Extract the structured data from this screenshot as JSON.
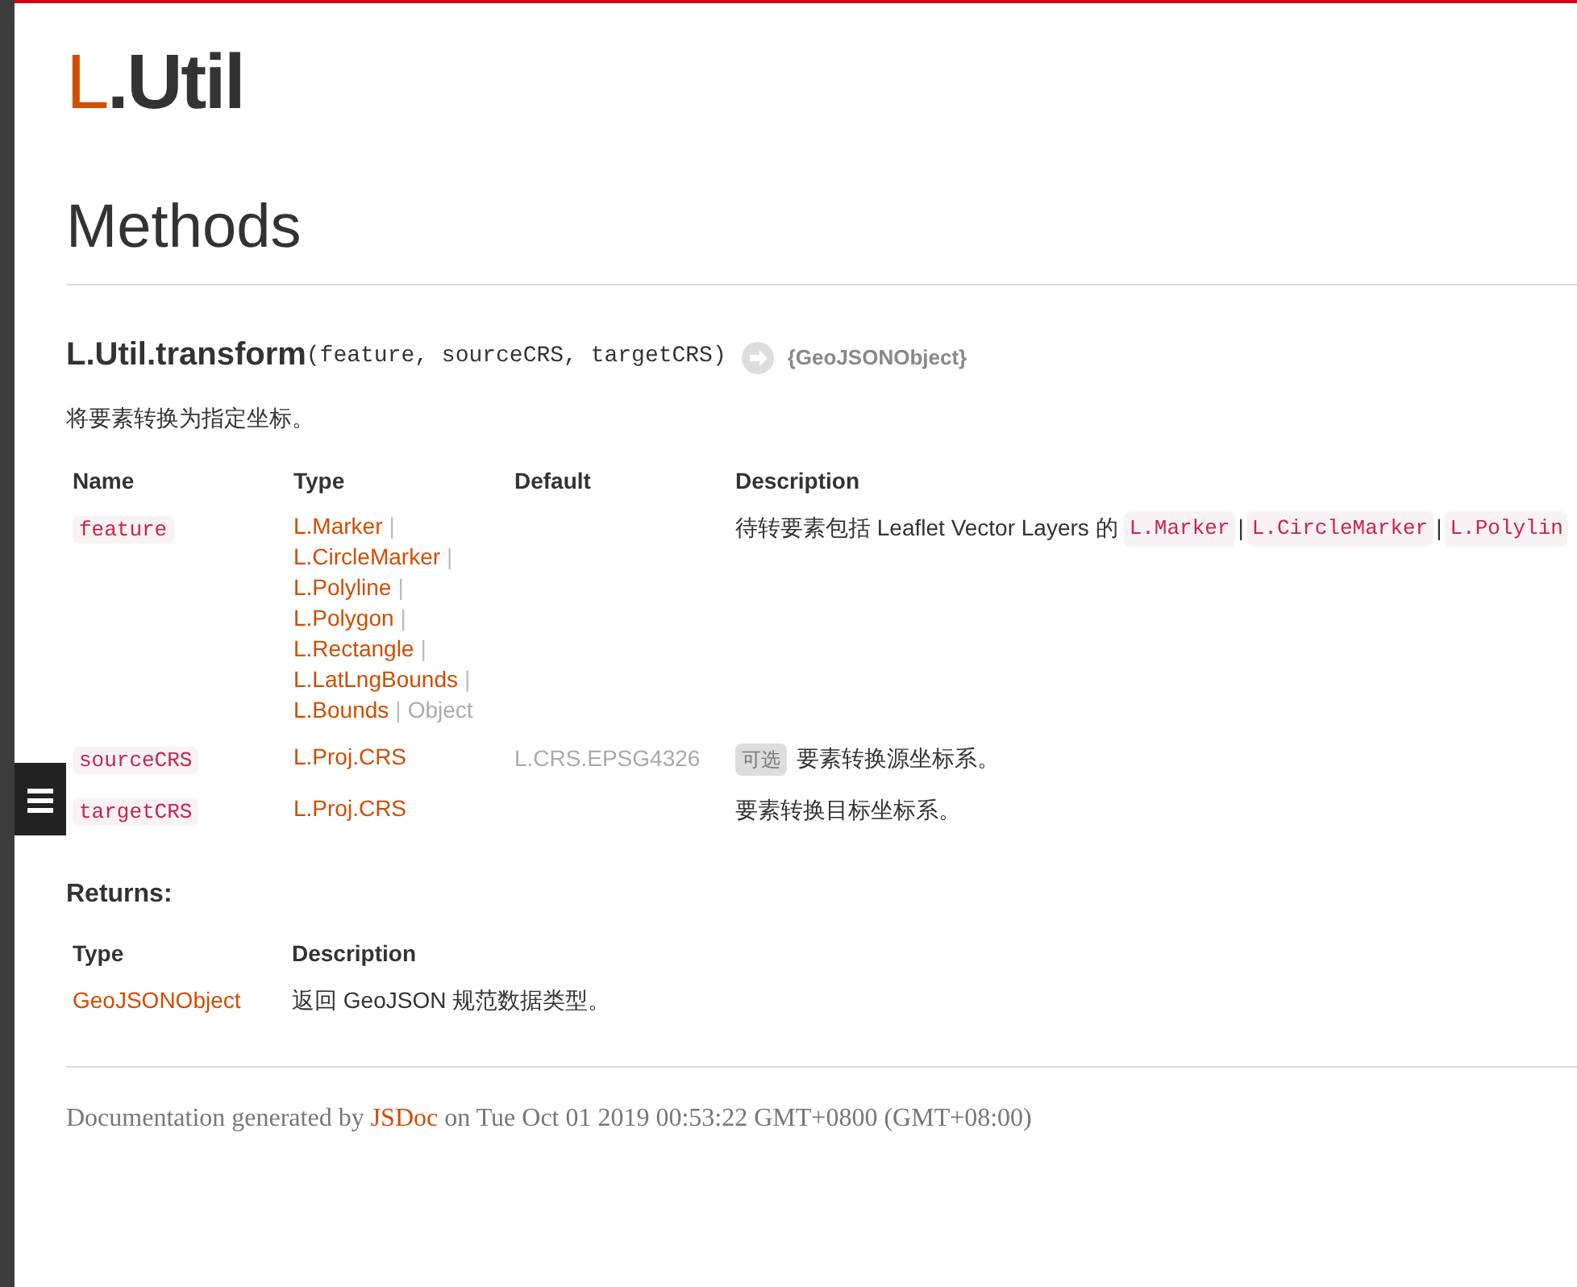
{
  "page_title": {
    "prefix": "L",
    "rest": ".Util"
  },
  "section_title": "Methods",
  "method": {
    "name": "L.Util.transform",
    "signature": "(feature, sourceCRS, targetCRS)",
    "returns": "{GeoJSONObject}",
    "description": "将要素转换为指定坐标。"
  },
  "params": {
    "columns": [
      "Name",
      "Type",
      "Default",
      "Description"
    ],
    "rows": [
      {
        "name": "feature",
        "type_lines": [
          [
            {
              "kind": "link",
              "text": "L.Marker"
            },
            {
              "kind": "sep",
              "text": "|"
            }
          ],
          [
            {
              "kind": "link",
              "text": "L.CircleMarker"
            },
            {
              "kind": "sep",
              "text": "|"
            }
          ],
          [
            {
              "kind": "link",
              "text": "L.Polyline"
            },
            {
              "kind": "sep",
              "text": "|"
            }
          ],
          [
            {
              "kind": "link",
              "text": "L.Polygon"
            },
            {
              "kind": "sep",
              "text": "|"
            }
          ],
          [
            {
              "kind": "link",
              "text": "L.Rectangle"
            },
            {
              "kind": "sep",
              "text": "|"
            }
          ],
          [
            {
              "kind": "link",
              "text": "L.LatLngBounds"
            },
            {
              "kind": "sep",
              "text": "|"
            }
          ],
          [
            {
              "kind": "link",
              "text": "L.Bounds"
            },
            {
              "kind": "sep",
              "text": "|"
            },
            {
              "kind": "plain",
              "text": "Object"
            }
          ]
        ],
        "description": [
          {
            "kind": "text",
            "text": "待转要素包括 Leaflet Vector Layers 的"
          },
          {
            "kind": "code",
            "text": "L.Marker"
          },
          {
            "kind": "sep",
            "text": "|"
          },
          {
            "kind": "code",
            "text": "L.CircleMarker"
          },
          {
            "kind": "sep",
            "text": "|"
          },
          {
            "kind": "code",
            "text": "L.Polylin"
          }
        ]
      },
      {
        "name": "sourceCRS",
        "type_lines": [
          [
            {
              "kind": "link",
              "text": "L.Proj.CRS"
            }
          ]
        ],
        "default": "L.CRS.EPSG4326",
        "description": [
          {
            "kind": "badge",
            "text": "可选"
          },
          {
            "kind": "text",
            "text": "要素转换源坐标系。"
          }
        ]
      },
      {
        "name": "targetCRS",
        "type_lines": [
          [
            {
              "kind": "link",
              "text": "L.Proj.CRS"
            }
          ]
        ],
        "description": [
          {
            "kind": "text",
            "text": "要素转换目标坐标系。"
          }
        ]
      }
    ]
  },
  "returns": {
    "heading": "Returns:",
    "columns": [
      "Type",
      "Description"
    ],
    "rows": [
      {
        "type": "GeoJSONObject",
        "description": "返回 GeoJSON 规范数据类型。"
      }
    ]
  },
  "footer": [
    {
      "kind": "text",
      "text": "Documentation generated by"
    },
    {
      "kind": "link",
      "text": "JSDoc"
    },
    {
      "kind": "text",
      "text": "on Tue Oct 01 2019 00:53:22 GMT+0800 (GMT+08:00)"
    }
  ]
}
